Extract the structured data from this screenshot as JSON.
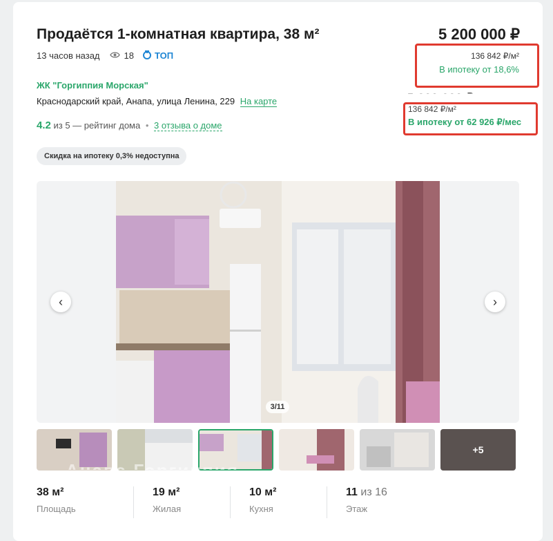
{
  "listing": {
    "title": "Продаётся 1-комнатная квартира, 38 м²",
    "price": "5 200 000 ₽",
    "posted": "13 часов назад",
    "views": "18",
    "top_label": "ТОП",
    "price_per_m2": "136 842 ₽/м²",
    "mortgage_rate": "В ипотеку от 18,6%",
    "price_ghost": "5 200 000 ₽",
    "price_per_m2_alt": "136 842 ₽/м²",
    "mortgage_monthly": "В ипотеку от 62 926 ₽/мес",
    "complex": "ЖК \"Горгиппия Морская\"",
    "address": "Краснодарский край, Анапа, улица Ленина, 229",
    "map_link": "На карте",
    "rating_value": "4.2",
    "rating_text": "из 5 — рейтинг дома",
    "rating_dot": "•",
    "reviews_link": "3 отзыва о доме",
    "discount_chip": "Скидка на ипотеку 0,3% недоступна"
  },
  "gallery": {
    "counter": "3/11",
    "prev": "‹",
    "next": "›",
    "more_label": "+5",
    "watermark": "Анапа Горгиппия"
  },
  "stats": [
    {
      "value": "38 м²",
      "label": "Площадь"
    },
    {
      "value": "19 м²",
      "label": "Жилая"
    },
    {
      "value": "10 м²",
      "label": "Кухня"
    },
    {
      "value_main": "11",
      "value_rest": "из 16",
      "label": "Этаж"
    }
  ],
  "colors": {
    "accent_green": "#2aa66a",
    "highlight_red": "#e03a2f",
    "top_blue": "#1f86d4"
  },
  "icons": [
    "eye-icon",
    "top-icon",
    "chevron-left-icon",
    "chevron-right-icon"
  ]
}
